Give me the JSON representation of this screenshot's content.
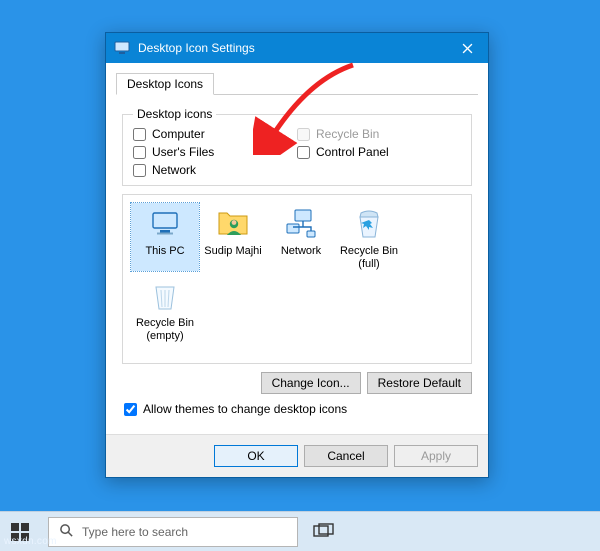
{
  "window": {
    "title": "Desktop Icon Settings"
  },
  "tab": {
    "label": "Desktop Icons"
  },
  "group": {
    "legend": "Desktop icons",
    "checks": {
      "computer": "Computer",
      "users_files": "User's Files",
      "network": "Network",
      "recycle_bin": "Recycle Bin",
      "control_panel": "Control Panel"
    }
  },
  "icons": [
    {
      "key": "this-pc",
      "label": "This PC"
    },
    {
      "key": "user",
      "label": "Sudip Majhi"
    },
    {
      "key": "network",
      "label": "Network"
    },
    {
      "key": "recycle-full",
      "label": "Recycle Bin (full)"
    },
    {
      "key": "recycle-empty",
      "label": "Recycle Bin (empty)"
    }
  ],
  "buttons": {
    "change_icon": "Change Icon...",
    "restore_default": "Restore Default",
    "ok": "OK",
    "cancel": "Cancel",
    "apply": "Apply"
  },
  "allow_themes": {
    "label": "Allow themes to change desktop icons",
    "checked": true
  },
  "taskbar": {
    "search_placeholder": "Type here to search"
  },
  "watermark": "wsxdn.com"
}
